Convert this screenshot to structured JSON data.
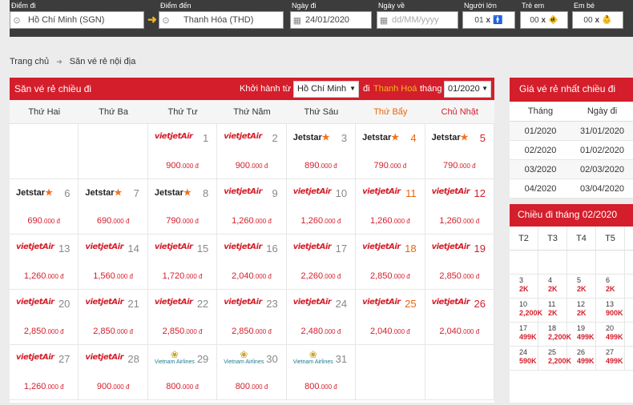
{
  "search": {
    "from_label": "Điểm đi",
    "from_value": "Hồ Chí Minh (SGN)",
    "to_label": "Điểm đến",
    "to_value": "Thanh Hóa (THD)",
    "depart_label": "Ngày đi",
    "depart_value": "24/01/2020",
    "return_label": "Ngày về",
    "return_placeholder": "dd/MM/yyyy",
    "adult_label": "Người lớn",
    "adult_value": "01",
    "child_label": "Trẻ em",
    "child_value": "00",
    "infant_label": "Em bé",
    "infant_value": "00"
  },
  "breadcrumb": {
    "home": "Trang chủ",
    "current": "Săn vé rẻ nội địa"
  },
  "calendar": {
    "title": "Săn vé rẻ chiều đi",
    "depart_from_label": "Khởi hành từ",
    "depart_from_value": "Hồ Chí Minh",
    "to_prefix": "đi",
    "destination": "Thanh Hoá",
    "month_label": "tháng",
    "month_value": "01/2020",
    "weekdays": [
      "Thứ Hai",
      "Thứ Ba",
      "Thứ Tư",
      "Thứ Năm",
      "Thứ Sáu",
      "Thứ Bẩy",
      "Chủ Nhật"
    ],
    "cells": [
      null,
      null,
      {
        "day": "1",
        "airline": "vietjet",
        "price": "900",
        "unit": ".000 đ"
      },
      {
        "day": "2",
        "airline": "vietjet",
        "price": "900",
        "unit": ".000 đ"
      },
      {
        "day": "3",
        "airline": "jetstar",
        "price": "890",
        "unit": ".000 đ"
      },
      {
        "day": "4",
        "airline": "jetstar",
        "price": "790",
        "unit": ".000 đ"
      },
      {
        "day": "5",
        "airline": "jetstar",
        "price": "790",
        "unit": ".000 đ"
      },
      {
        "day": "6",
        "airline": "jetstar",
        "price": "690",
        "unit": ".000 đ"
      },
      {
        "day": "7",
        "airline": "jetstar",
        "price": "690",
        "unit": ".000 đ"
      },
      {
        "day": "8",
        "airline": "jetstar",
        "price": "790",
        "unit": ".000 đ"
      },
      {
        "day": "9",
        "airline": "vietjet",
        "price": "1,260",
        "unit": ".000 đ"
      },
      {
        "day": "10",
        "airline": "vietjet",
        "price": "1,260",
        "unit": ".000 đ"
      },
      {
        "day": "11",
        "airline": "vietjet",
        "price": "1,260",
        "unit": ".000 đ"
      },
      {
        "day": "12",
        "airline": "vietjet",
        "price": "1,260",
        "unit": ".000 đ"
      },
      {
        "day": "13",
        "airline": "vietjet",
        "price": "1,260",
        "unit": ".000 đ"
      },
      {
        "day": "14",
        "airline": "vietjet",
        "price": "1,560",
        "unit": ".000 đ"
      },
      {
        "day": "15",
        "airline": "vietjet",
        "price": "1,720",
        "unit": ".000 đ"
      },
      {
        "day": "16",
        "airline": "vietjet",
        "price": "2,040",
        "unit": ".000 đ"
      },
      {
        "day": "17",
        "airline": "vietjet",
        "price": "2,260",
        "unit": ".000 đ"
      },
      {
        "day": "18",
        "airline": "vietjet",
        "price": "2,850",
        "unit": ".000 đ"
      },
      {
        "day": "19",
        "airline": "vietjet",
        "price": "2,850",
        "unit": ".000 đ"
      },
      {
        "day": "20",
        "airline": "vietjet",
        "price": "2,850",
        "unit": ".000 đ"
      },
      {
        "day": "21",
        "airline": "vietjet",
        "price": "2,850",
        "unit": ".000 đ"
      },
      {
        "day": "22",
        "airline": "vietjet",
        "price": "2,850",
        "unit": ".000 đ"
      },
      {
        "day": "23",
        "airline": "vietjet",
        "price": "2,850",
        "unit": ".000 đ"
      },
      {
        "day": "24",
        "airline": "vietjet",
        "price": "2,480",
        "unit": ".000 đ"
      },
      {
        "day": "25",
        "airline": "vietjet",
        "price": "2,040",
        "unit": ".000 đ"
      },
      {
        "day": "26",
        "airline": "vietjet",
        "price": "2,040",
        "unit": ".000 đ"
      },
      {
        "day": "27",
        "airline": "vietjet",
        "price": "1,260",
        "unit": ".000 đ"
      },
      {
        "day": "28",
        "airline": "vietjet",
        "price": "900",
        "unit": ".000 đ"
      },
      {
        "day": "29",
        "airline": "vna",
        "price": "800",
        "unit": ".000 đ"
      },
      {
        "day": "30",
        "airline": "vna",
        "price": "800",
        "unit": ".000 đ"
      },
      {
        "day": "31",
        "airline": "vna",
        "price": "800",
        "unit": ".000 đ"
      },
      null,
      null
    ]
  },
  "airlines": {
    "vietjet": "vietjetAir",
    "jetstar": "Jetstar",
    "vna": "Vietnam Airlines"
  },
  "cheapest": {
    "title": "Giá vé rẻ nhất chiều đi",
    "col_month": "Tháng",
    "col_day": "Ngày đi",
    "rows": [
      {
        "month": "01/2020",
        "day": "31/01/2020"
      },
      {
        "month": "02/2020",
        "day": "01/02/2020"
      },
      {
        "month": "03/2020",
        "day": "02/03/2020"
      },
      {
        "month": "04/2020",
        "day": "03/04/2020"
      }
    ]
  },
  "mini": {
    "title": "Chiều đi tháng 02/2020",
    "weekdays": [
      "T2",
      "T3",
      "T4",
      "T5"
    ],
    "cells": [
      null,
      null,
      null,
      null,
      null,
      {
        "d": "3",
        "p": "2K"
      },
      {
        "d": "4",
        "p": "2K"
      },
      {
        "d": "5",
        "p": "2K"
      },
      {
        "d": "6",
        "p": "2K"
      },
      null,
      {
        "d": "10",
        "p": "2,200K"
      },
      {
        "d": "11",
        "p": "2K"
      },
      {
        "d": "12",
        "p": "2K"
      },
      {
        "d": "13",
        "p": "900K"
      },
      null,
      {
        "d": "17",
        "p": "499K"
      },
      {
        "d": "18",
        "p": "2,200K"
      },
      {
        "d": "19",
        "p": "499K"
      },
      {
        "d": "20",
        "p": "499K"
      },
      null,
      {
        "d": "24",
        "p": "590K"
      },
      {
        "d": "25",
        "p": "2,200K"
      },
      {
        "d": "26",
        "p": "499K"
      },
      {
        "d": "27",
        "p": "499K"
      },
      null
    ]
  }
}
